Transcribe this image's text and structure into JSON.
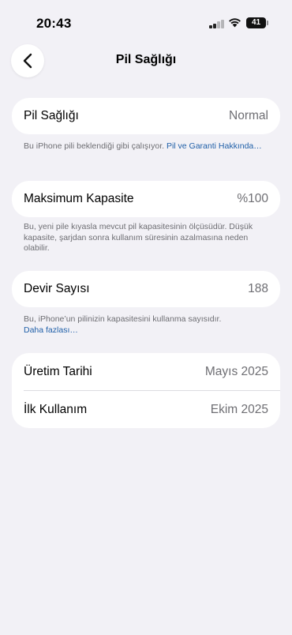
{
  "status_bar": {
    "time": "20:43",
    "battery_level": "41"
  },
  "nav": {
    "title": "Pil Sağlığı"
  },
  "battery_health": {
    "label": "Pil Sağlığı",
    "value": "Normal",
    "note": "Bu iPhone pili beklendiği gibi çalışıyor.",
    "link": "Pil ve Garanti Hakkında…"
  },
  "max_capacity": {
    "label": "Maksimum Kapasite",
    "value": "%100",
    "note": "Bu, yeni pile kıyasla mevcut pil kapasitesinin ölçüsüdür. Düşük kapasite, şarjdan sonra kullanım süresinin azalmasına neden olabilir."
  },
  "cycle_count": {
    "label": "Devir Sayısı",
    "value": "188",
    "note": "Bu, iPhone’un pilinizin kapasitesini kullanma sayısıdır.",
    "link": "Daha fazlası…"
  },
  "dates": {
    "manufacture_label": "Üretim Tarihi",
    "manufacture_value": "Mayıs 2025",
    "first_use_label": "İlk Kullanım",
    "first_use_value": "Ekim 2025"
  },
  "colors": {
    "background": "#f2f1f6",
    "link": "#1f5fa8",
    "secondary_text": "#6e6e73"
  }
}
